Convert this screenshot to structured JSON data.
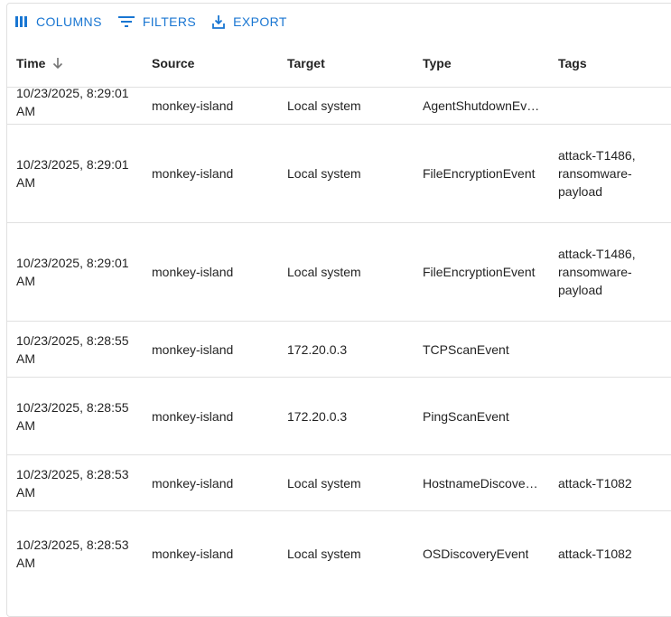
{
  "toolbar": {
    "columns": "COLUMNS",
    "filters": "FILTERS",
    "export": "EXPORT",
    "accent_color": "#1976d2"
  },
  "columns": {
    "time": "Time",
    "source": "Source",
    "target": "Target",
    "type": "Type",
    "tags": "Tags",
    "sort_icon": "arrow-down-icon"
  },
  "rows": [
    {
      "time": "10/23/2025, 8:29:01 AM",
      "source": "monkey-island",
      "target": "Local system",
      "type": "AgentShutdownEvent",
      "tags": ""
    },
    {
      "time": "10/23/2025, 8:29:01 AM",
      "source": "monkey-island",
      "target": "Local system",
      "type": "FileEncryptionEvent",
      "tags": "attack-T1486, ransomware-payload"
    },
    {
      "time": "10/23/2025, 8:29:01 AM",
      "source": "monkey-island",
      "target": "Local system",
      "type": "FileEncryptionEvent",
      "tags": "attack-T1486, ransomware-payload"
    },
    {
      "time": "10/23/2025, 8:28:55 AM",
      "source": "monkey-island",
      "target": "172.20.0.3",
      "type": "TCPScanEvent",
      "tags": ""
    },
    {
      "time": "10/23/2025, 8:28:55 AM",
      "source": "monkey-island",
      "target": "172.20.0.3",
      "type": "PingScanEvent",
      "tags": ""
    },
    {
      "time": "10/23/2025, 8:28:53 AM",
      "source": "monkey-island",
      "target": "Local system",
      "type": "HostnameDiscoveryEvent",
      "tags": "attack-T1082"
    },
    {
      "time": "10/23/2025, 8:28:53 AM",
      "source": "monkey-island",
      "target": "Local system",
      "type": "OSDiscoveryEvent",
      "tags": "attack-T1082"
    }
  ]
}
